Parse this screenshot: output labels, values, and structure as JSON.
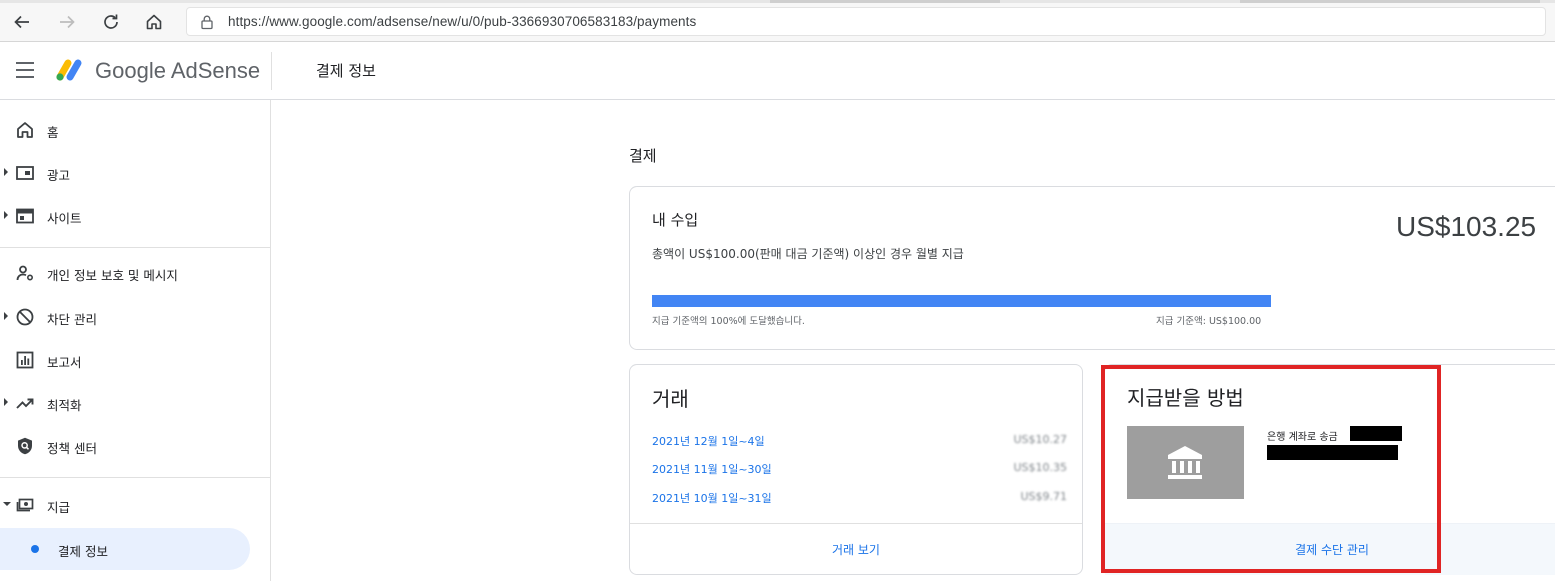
{
  "browser": {
    "url": "https://www.google.com/adsense/new/u/0/pub-3366930706583183/payments"
  },
  "header": {
    "brand": "Google AdSense",
    "page_title": "결제 정보"
  },
  "sidebar": {
    "items": [
      {
        "label": "홈",
        "icon": "home-icon",
        "caret": false
      },
      {
        "label": "광고",
        "icon": "ads-icon",
        "caret": true
      },
      {
        "label": "사이트",
        "icon": "sites-icon",
        "caret": true
      },
      {
        "label": "개인 정보 보호 및 메시지",
        "icon": "privacy-icon",
        "caret": false
      },
      {
        "label": "차단 관리",
        "icon": "block-icon",
        "caret": true
      },
      {
        "label": "보고서",
        "icon": "report-icon",
        "caret": false
      },
      {
        "label": "최적화",
        "icon": "trending-icon",
        "caret": true
      },
      {
        "label": "정책 센터",
        "icon": "policy-icon",
        "caret": false
      },
      {
        "label": "지급",
        "icon": "payments-icon",
        "caret": true
      }
    ],
    "active_sub": "결제 정보"
  },
  "main": {
    "section_title": "결제",
    "earnings": {
      "title": "내 수입",
      "subtitle": "총액이 US$100.00(판매 대금 기준액) 이상인 경우 월별 지급",
      "amount": "US$103.25",
      "progress_fraction": 1.0,
      "progress_left": "지급 기준액의 100%에 도달했습니다.",
      "progress_right": "지급 기준액: US$100.00"
    },
    "transactions": {
      "title": "거래",
      "rows": [
        {
          "period": "2021년 12월 1일~4일",
          "amount": "US$10.27"
        },
        {
          "period": "2021년 11월 1일~30일",
          "amount": "US$10.35"
        },
        {
          "period": "2021년 10월 1일~31일",
          "amount": "US$9.71"
        }
      ],
      "view_link": "거래 보기"
    },
    "payment_method": {
      "title": "지급받을 방법",
      "method_label": "은행 계좌로 송금",
      "manage_link": "결제 수단 관리"
    }
  },
  "colors": {
    "accent": "#1a73e8",
    "progress": "#4285f4",
    "highlight": "#e02424"
  }
}
